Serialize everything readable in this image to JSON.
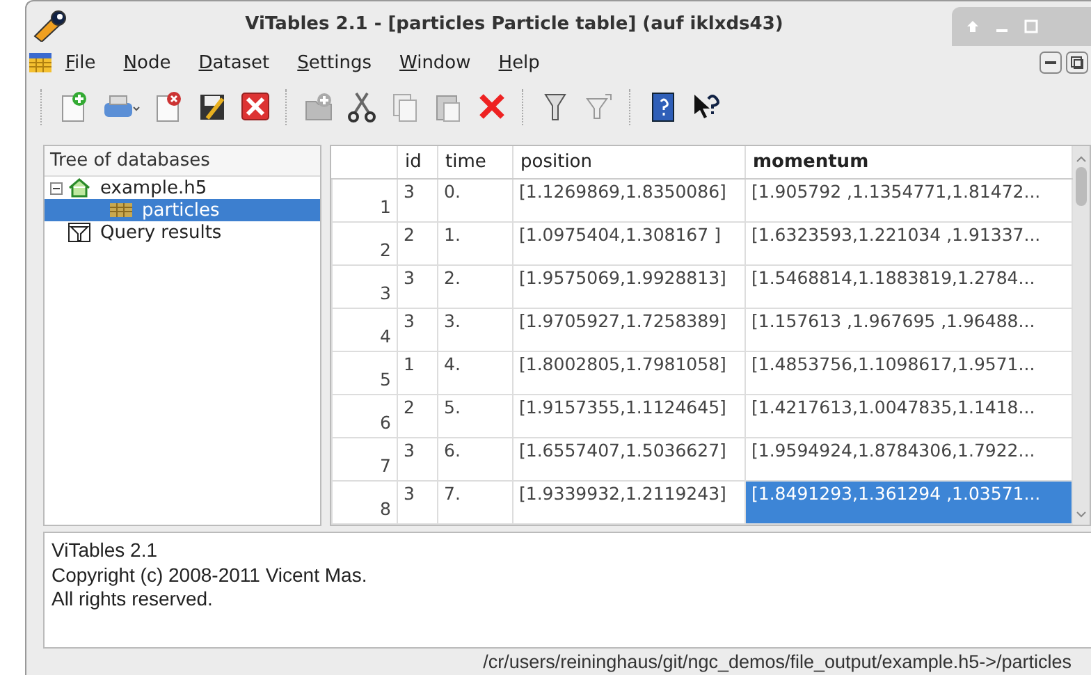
{
  "window": {
    "title": "ViTables 2.1 - [particles Particle table] (auf iklxds43)"
  },
  "menu": [
    "File",
    "Node",
    "Dataset",
    "Settings",
    "Window",
    "Help"
  ],
  "tree": {
    "header": "Tree of databases",
    "items": [
      {
        "label": "example.h5",
        "kind": "file",
        "expanded": true,
        "selected": false,
        "children": [
          {
            "label": "particles",
            "kind": "table",
            "selected": true
          }
        ]
      },
      {
        "label": "Query results",
        "kind": "queries",
        "selected": false
      }
    ]
  },
  "table": {
    "columns": [
      "id",
      "time",
      "position",
      "momentum"
    ],
    "rows": [
      {
        "number": "1",
        "cells": [
          {
            "text": "3",
            "selected": false
          },
          {
            "text": "0.",
            "selected": false
          },
          {
            "text": "[1.1269869,1.8350086]",
            "selected": false
          },
          {
            "text": "[1.905792 ,1.1354771,1.81472...",
            "selected": false
          }
        ]
      },
      {
        "number": "2",
        "cells": [
          {
            "text": "2",
            "selected": false
          },
          {
            "text": "1.",
            "selected": false
          },
          {
            "text": "[1.0975404,1.308167 ]",
            "selected": false
          },
          {
            "text": "[1.6323593,1.221034 ,1.91337...",
            "selected": false
          }
        ]
      },
      {
        "number": "3",
        "cells": [
          {
            "text": "3",
            "selected": false
          },
          {
            "text": "2.",
            "selected": false
          },
          {
            "text": "[1.9575069,1.9928813]",
            "selected": false
          },
          {
            "text": "[1.5468814,1.1883819,1.2784...",
            "selected": false
          }
        ]
      },
      {
        "number": "4",
        "cells": [
          {
            "text": "3",
            "selected": false
          },
          {
            "text": "3.",
            "selected": false
          },
          {
            "text": "[1.9705927,1.7258389]",
            "selected": false
          },
          {
            "text": "[1.157613 ,1.967695 ,1.96488...",
            "selected": false
          }
        ]
      },
      {
        "number": "5",
        "cells": [
          {
            "text": "1",
            "selected": false
          },
          {
            "text": "4.",
            "selected": false
          },
          {
            "text": "[1.8002805,1.7981058]",
            "selected": false
          },
          {
            "text": "[1.4853756,1.1098617,1.9571...",
            "selected": false
          }
        ]
      },
      {
        "number": "6",
        "cells": [
          {
            "text": "2",
            "selected": false
          },
          {
            "text": "5.",
            "selected": false
          },
          {
            "text": "[1.9157355,1.1124645]",
            "selected": false
          },
          {
            "text": "[1.4217613,1.0047835,1.1418...",
            "selected": false
          }
        ]
      },
      {
        "number": "7",
        "cells": [
          {
            "text": "3",
            "selected": false
          },
          {
            "text": "6.",
            "selected": false
          },
          {
            "text": "[1.6557407,1.5036627]",
            "selected": false
          },
          {
            "text": "[1.9594924,1.8784306,1.7922...",
            "selected": false
          }
        ]
      },
      {
        "number": "8",
        "cells": [
          {
            "text": "3",
            "selected": false
          },
          {
            "text": "7.",
            "selected": false
          },
          {
            "text": "[1.9339932,1.2119243]",
            "selected": false
          },
          {
            "text": "[1.8491293,1.361294 ,1.03571...",
            "selected": true
          }
        ]
      }
    ]
  },
  "log": [
    "ViTables 2.1",
    "Copyright (c) 2008-2011 Vicent Mas.",
    "All rights reserved."
  ],
  "status_bar": "/cr/users/reininghaus/git/ngc_demos/file_output/example.h5->/particles"
}
